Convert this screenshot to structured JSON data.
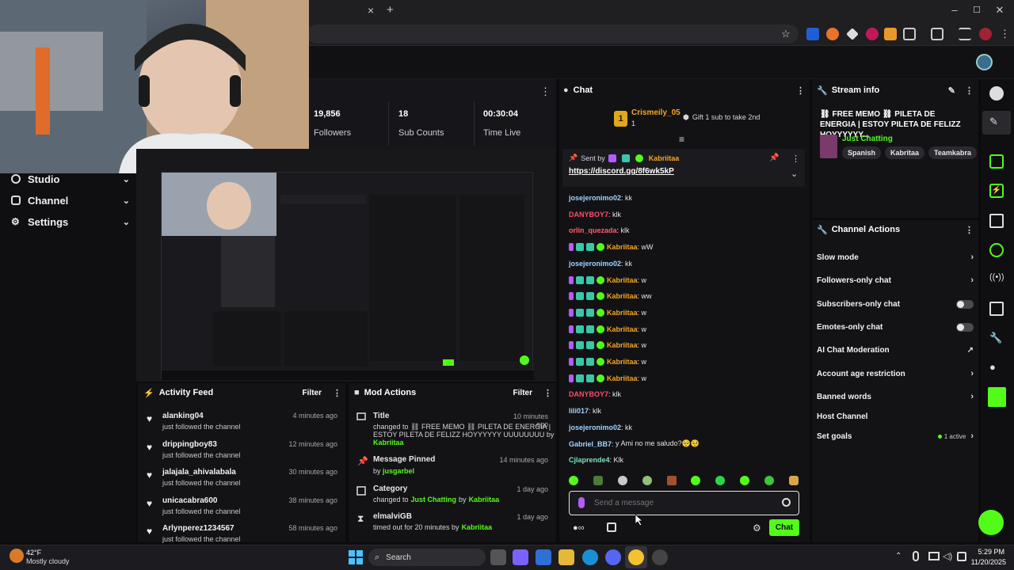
{
  "browser": {
    "close_tab": "×",
    "new_tab": "+",
    "window_controls": [
      "–",
      "☐",
      "✕"
    ]
  },
  "nav": {
    "items": [
      {
        "label": "Studio",
        "icon": "studio-icon"
      },
      {
        "label": "Channel",
        "icon": "channel-icon"
      },
      {
        "label": "Settings",
        "icon": "gear-icon"
      }
    ]
  },
  "stats": [
    {
      "value": "19,856",
      "label": "Followers"
    },
    {
      "value": "18",
      "label": "Sub Counts"
    },
    {
      "value": "00:30:04",
      "label": "Time Live"
    }
  ],
  "activity_feed": {
    "title": "Activity Feed",
    "filter_label": "Filter",
    "items": [
      {
        "name": "alanking04",
        "action": "just followed the channel",
        "time": "4 minutes ago"
      },
      {
        "name": "drippingboy83",
        "action": "just followed the channel",
        "time": "12 minutes ago"
      },
      {
        "name": "jalajala_ahivalabala",
        "action": "just followed the channel",
        "time": "30 minutes ago"
      },
      {
        "name": "unicacabra600",
        "action": "just followed the channel",
        "time": "38 minutes ago"
      },
      {
        "name": "Arlynperez1234567",
        "action": "just followed the channel",
        "time": "58 minutes ago"
      }
    ]
  },
  "mod_actions": {
    "title": "Mod Actions",
    "filter_label": "Filter",
    "items": [
      {
        "title": "Title",
        "time": "10 minutes ago",
        "line1": "changed to ⛓ FREE MEMO ⛓ PILETA DE ENERGIA |",
        "line2": "ESTOY PILETA DE FELIZZ HOYYYYYY UUUUUUUU by",
        "user": "Kabriitaa"
      },
      {
        "title": "Message Pinned",
        "time": "14 minutes ago",
        "line1": "by",
        "user": "jusgarbel"
      },
      {
        "title": "Category",
        "time": "1 day ago",
        "line1": "changed to",
        "category": "Just Chatting",
        "by": "by",
        "user": "Kabriitaa"
      },
      {
        "title": "elmalviGB",
        "time": "1 day ago",
        "line1": "timed out for 20 minutes by",
        "user": "Kabriitaa"
      }
    ]
  },
  "chat": {
    "title": "Chat",
    "leader": {
      "rank": "1",
      "name": "Crismeily_05",
      "count": "1"
    },
    "gift_text": "Gift 1 sub to take 2nd",
    "pinned": {
      "sent_by": "Sent by",
      "user": "Kabriitaa",
      "link": "https://discord.gg/8f6wk5kP"
    },
    "messages": [
      {
        "user": "josejeronimo02",
        "text": "kk",
        "color": "#9fd3ff",
        "badges": false
      },
      {
        "user": "DANYBOY7",
        "text": "klk",
        "color": "#ff4d6a",
        "badges": false
      },
      {
        "user": "orlin_quezada",
        "text": "klk",
        "color": "#ff5f6d",
        "badges": false
      },
      {
        "user": "Kabriitaa",
        "text": "wW",
        "color": "#f5a623",
        "badges": true
      },
      {
        "user": "josejeronimo02",
        "text": "kk",
        "color": "#9fd3ff",
        "badges": false
      },
      {
        "user": "Kabriitaa",
        "text": "w",
        "color": "#f5a623",
        "badges": true
      },
      {
        "user": "Kabriitaa",
        "text": "ww",
        "color": "#f5a623",
        "badges": true
      },
      {
        "user": "Kabriitaa",
        "text": "w",
        "color": "#f5a623",
        "badges": true
      },
      {
        "user": "Kabriitaa",
        "text": "w",
        "color": "#f5a623",
        "badges": true
      },
      {
        "user": "Kabriitaa",
        "text": "w",
        "color": "#f5a623",
        "badges": true
      },
      {
        "user": "Kabriitaa",
        "text": "w",
        "color": "#f5a623",
        "badges": true
      },
      {
        "user": "Kabriitaa",
        "text": "w",
        "color": "#f5a623",
        "badges": true
      },
      {
        "user": "DANYBOY7",
        "text": "klk",
        "color": "#ff4d6a",
        "badges": false
      },
      {
        "user": "lili017",
        "text": "klk",
        "color": "#9fd3ff",
        "badges": false
      },
      {
        "user": "josejeronimo02",
        "text": "kk",
        "color": "#9fd3ff",
        "badges": false
      },
      {
        "user": "Gabriel_BB7",
        "text": "y Ami no me saludo?🥺🥺",
        "color": "#9fd3ff",
        "badges": false
      },
      {
        "user": "Cjlaprende4",
        "text": "Klk",
        "color": "#7fe0c0",
        "badges": false
      }
    ],
    "input_placeholder": "Send a message",
    "send_label": "Chat"
  },
  "stream_info": {
    "title": "Stream info",
    "stream_title": "⛓ FREE MEMO ⛓ PILETA DE ENERGIA | ESTOY PILETA DE FELIZZ HOYYYYYY...",
    "category": "Just Chatting",
    "tags": [
      "Spanish",
      "Kabritaa",
      "Teamkabra"
    ]
  },
  "channel_actions": {
    "title": "Channel Actions",
    "items": [
      {
        "label": "Slow mode",
        "control": "chevron"
      },
      {
        "label": "Followers-only chat",
        "control": "chevron"
      },
      {
        "label": "Subscribers-only chat",
        "control": "toggle"
      },
      {
        "label": "Emotes-only chat",
        "control": "toggle"
      },
      {
        "label": "AI Chat Moderation",
        "control": "external"
      },
      {
        "label": "Account age restriction",
        "control": "chevron"
      },
      {
        "label": "Banned words",
        "control": "chevron"
      },
      {
        "label": "Host Channel",
        "control": "none"
      },
      {
        "label": "Set goals",
        "control": "chevron",
        "status": "1 active"
      }
    ]
  },
  "taskbar": {
    "weather_temp": "42°F",
    "weather_desc": "Mostly cloudy",
    "search_label": "Search",
    "time": "5:29 PM",
    "date": "11/20/2025"
  },
  "colors": {
    "accent_green": "#53fc18",
    "username_orange": "#f5a623",
    "link": "#ffffff"
  }
}
